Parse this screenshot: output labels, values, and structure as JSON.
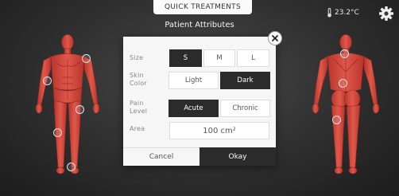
{
  "header": {
    "tab_label": "QUICK TREATMENTS",
    "title": "Patient Attributes",
    "temperature": "23.2°C"
  },
  "icons": {
    "thermometer": "thermometer-icon",
    "settings": "gear-icon",
    "close": "close-icon"
  },
  "dialog": {
    "size": {
      "label": "Size",
      "options": [
        "S",
        "M",
        "L"
      ],
      "selected": "S"
    },
    "skin_color": {
      "label_line1": "Skin",
      "label_line2": "Color",
      "options": [
        "Light",
        "Dark"
      ],
      "selected": "Dark"
    },
    "pain_level": {
      "label_line1": "Pain",
      "label_line2": "Level",
      "options": [
        "Acute",
        "Chronic"
      ],
      "selected": "Acute"
    },
    "area": {
      "label": "Area",
      "value": "100 cm²"
    },
    "cancel_label": "Cancel",
    "okay_label": "Okay"
  },
  "colors": {
    "muscle": "#d9463a",
    "selected": "#2b2b2b",
    "background": "#2e2e2e"
  }
}
